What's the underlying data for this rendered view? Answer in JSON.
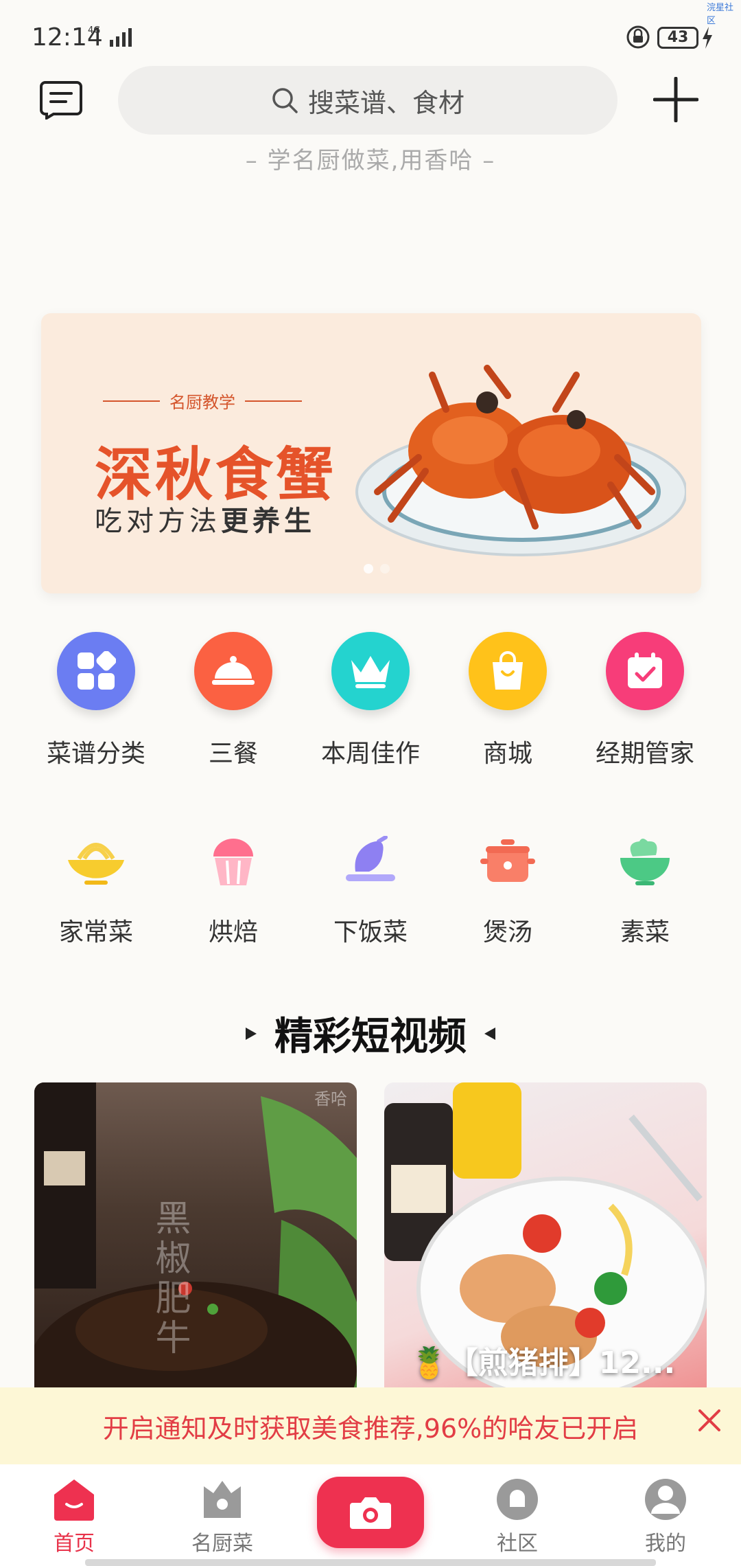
{
  "status_bar": {
    "time": "12:14",
    "network": "4G",
    "battery": "43",
    "corner_tag": "浣星社区"
  },
  "header": {
    "search_placeholder": "搜菜谱、食材",
    "slogan": "– 学名厨做菜,用香哈 –"
  },
  "banner": {
    "tagline": "名厨教学",
    "title": "深秋食蟹",
    "subtitle_plain": "吃对方法",
    "subtitle_bold": "更养生"
  },
  "quick_row1": [
    {
      "label": "菜谱分类",
      "icon": "grid-icon",
      "color": "#6b7df2"
    },
    {
      "label": "三餐",
      "icon": "cloche-icon",
      "color": "#fb6142"
    },
    {
      "label": "本周佳作",
      "icon": "crown-icon",
      "color": "#24d3cf"
    },
    {
      "label": "商城",
      "icon": "shopping-bag-icon",
      "color": "#ffc21a"
    },
    {
      "label": "经期管家",
      "icon": "calendar-check-icon",
      "color": "#f73d79"
    }
  ],
  "quick_row2": [
    {
      "label": "家常菜",
      "icon": "noodle-bowl-icon"
    },
    {
      "label": "烘焙",
      "icon": "cupcake-icon"
    },
    {
      "label": "下饭菜",
      "icon": "roast-chicken-icon"
    },
    {
      "label": "煲汤",
      "icon": "soup-pot-icon"
    },
    {
      "label": "素菜",
      "icon": "salad-bowl-icon"
    }
  ],
  "section": {
    "title": "精彩短视频"
  },
  "videos": [
    {
      "overlay_text": "黑椒肥牛",
      "watermark": "香哈",
      "caption": ""
    },
    {
      "overlay_text": "",
      "watermark": "",
      "caption": "🍍【煎猪排】12..."
    }
  ],
  "notification": {
    "text": "开启通知及时获取美食推荐,96%的哈友已开启"
  },
  "tabbar": {
    "tabs": [
      {
        "label": "首页",
        "active": true
      },
      {
        "label": "名厨菜",
        "active": false
      },
      {
        "label": "社区",
        "active": false
      },
      {
        "label": "我的",
        "active": false
      }
    ]
  }
}
